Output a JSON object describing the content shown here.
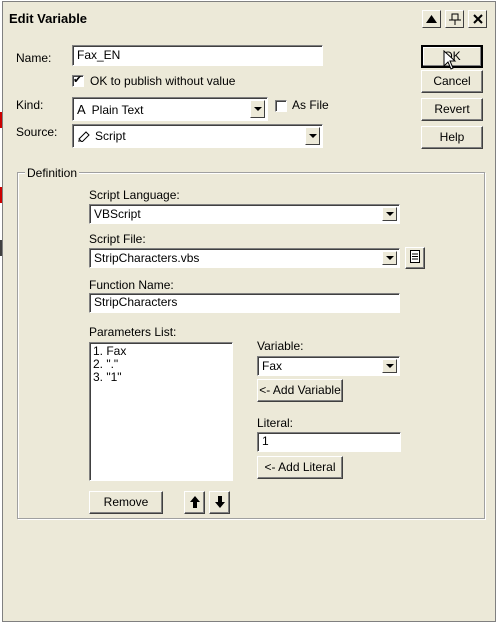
{
  "window": {
    "title": "Edit Variable"
  },
  "titlebar": {
    "up_icon": "up-arrow-icon",
    "pin_icon": "pin-icon",
    "close_icon": "close-icon"
  },
  "buttons": {
    "ok": "OK",
    "cancel": "Cancel",
    "revert": "Revert",
    "help": "Help"
  },
  "name": {
    "label": "Name:",
    "value": "Fax_EN"
  },
  "publish": {
    "label": "OK to publish without value",
    "checked": true
  },
  "kind": {
    "label": "Kind:",
    "value": "Plain Text",
    "icon": "A"
  },
  "as_file": {
    "label": "As File",
    "checked": false
  },
  "source": {
    "label": "Source:",
    "value": "Script",
    "icon": "script-icon"
  },
  "definition": {
    "legend": "Definition",
    "script_language": {
      "label": "Script Language:",
      "value": "VBScript"
    },
    "script_file": {
      "label": "Script File:",
      "value": "StripCharacters.vbs",
      "browse_icon": "document-icon"
    },
    "function_name": {
      "label": "Function Name:",
      "value": "StripCharacters"
    },
    "parameters": {
      "label": "Parameters List:",
      "items": [
        "1. Fax",
        "2. \".\"",
        "3. \"1\""
      ]
    },
    "variable": {
      "label": "Variable:",
      "value": "Fax",
      "add_label": "<- Add Variable"
    },
    "literal": {
      "label": "Literal:",
      "value": "1",
      "add_label": "<- Add Literal"
    },
    "remove_label": "Remove"
  },
  "colors": {
    "dialog_bg": "#ece9d8",
    "bg_red": "#cc0000"
  }
}
